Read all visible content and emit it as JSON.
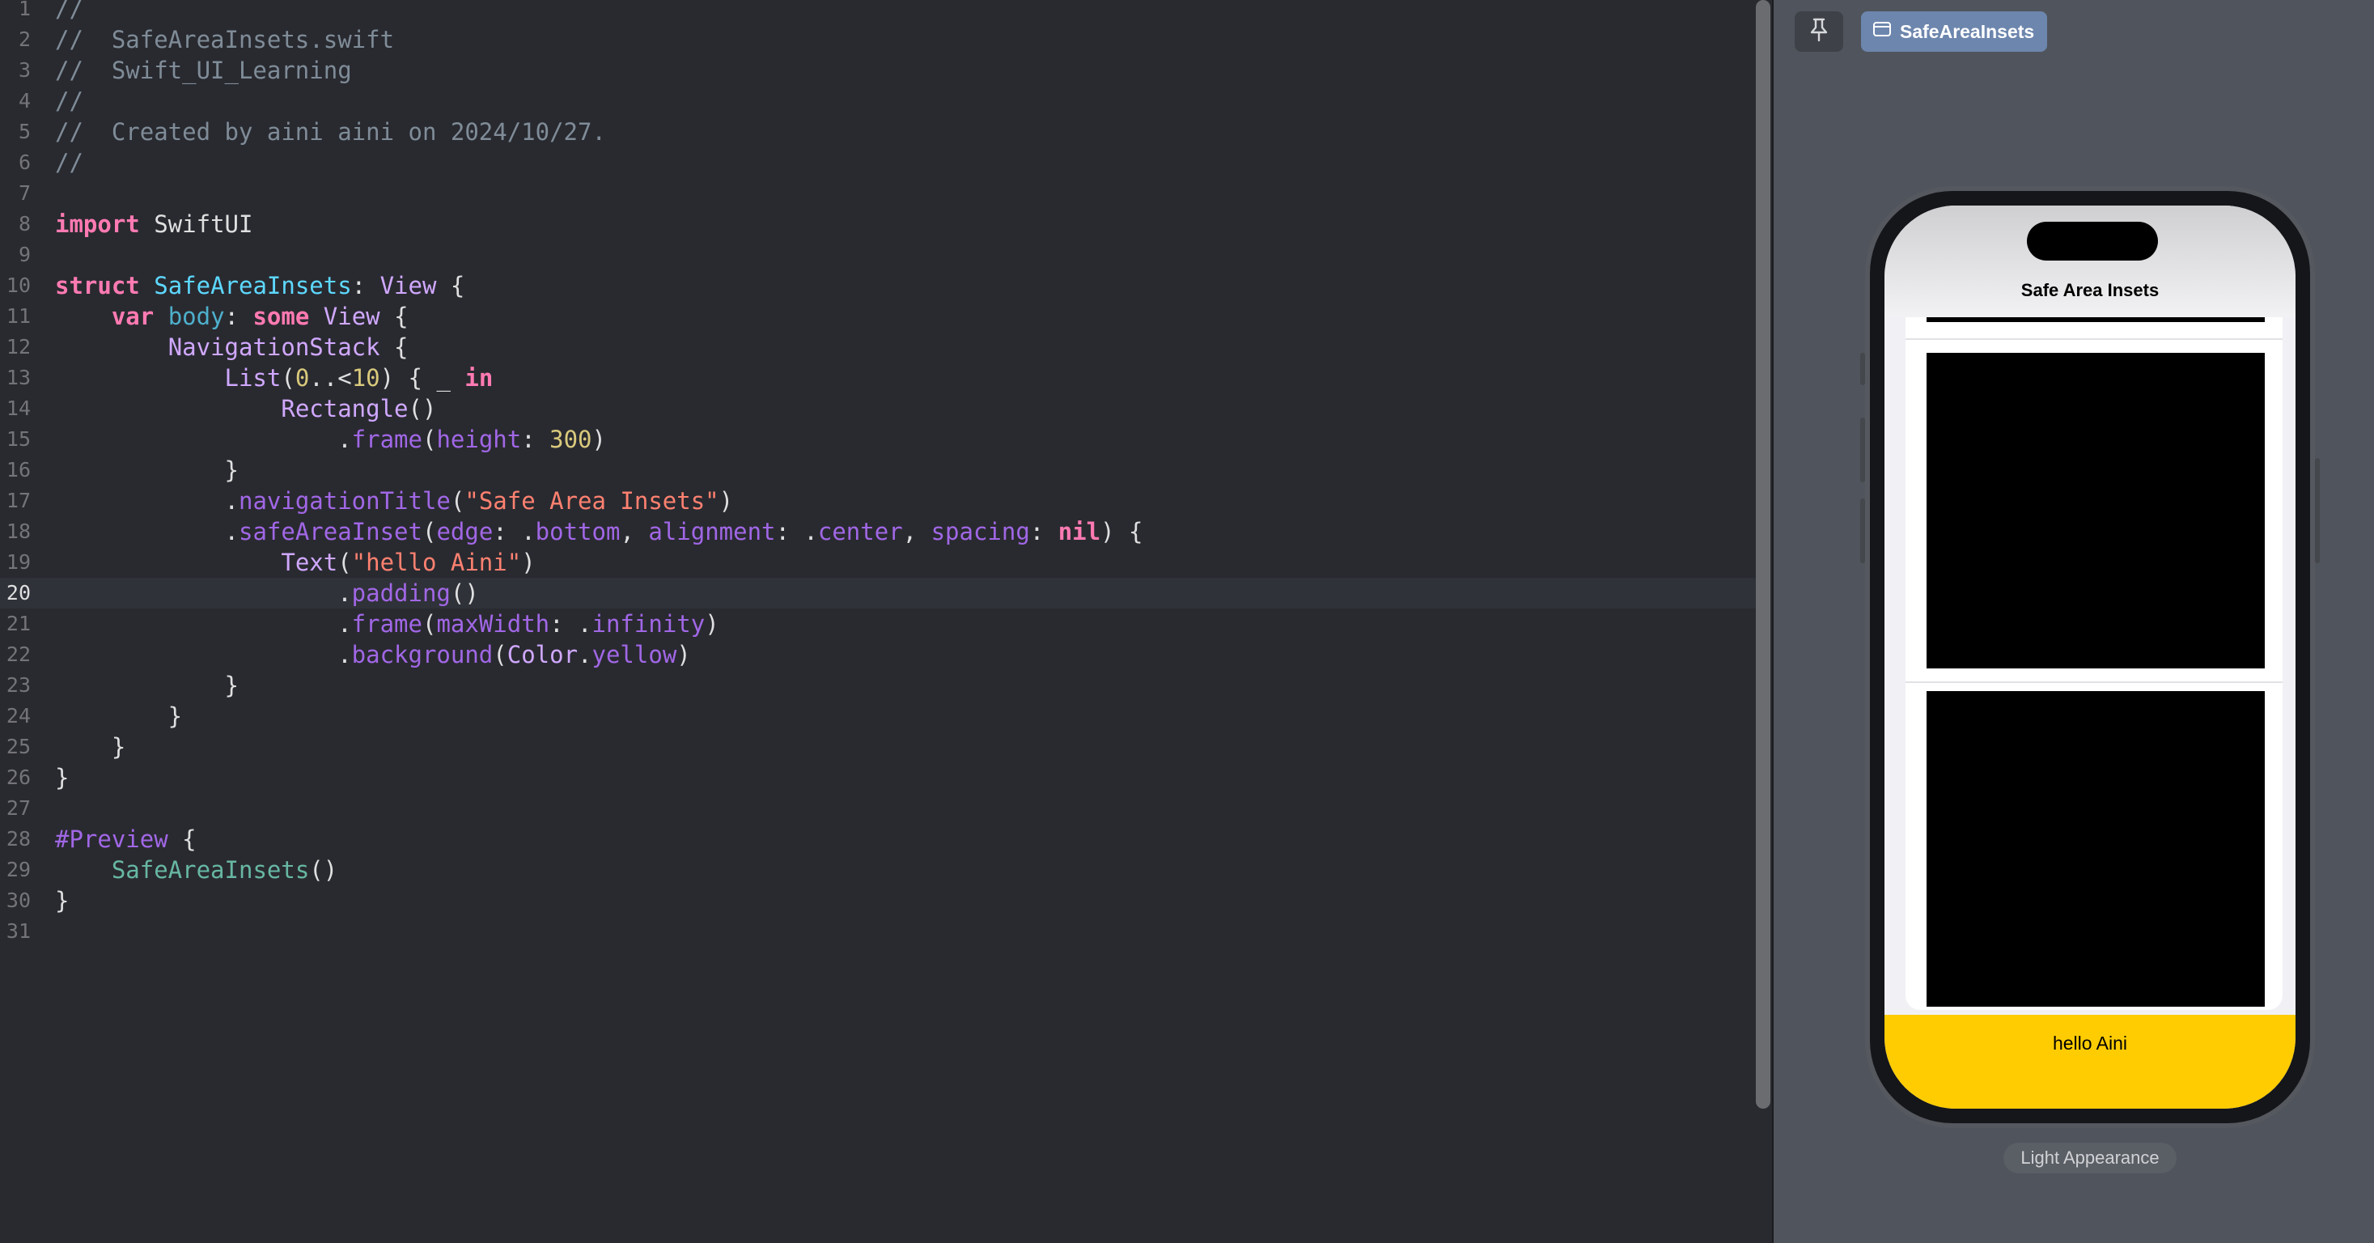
{
  "editor": {
    "current_line": 20,
    "lines": [
      {
        "n": "1",
        "tokens": [
          {
            "c": "com",
            "t": "//"
          }
        ]
      },
      {
        "n": "2",
        "tokens": [
          {
            "c": "com",
            "t": "//  SafeAreaInsets.swift"
          }
        ]
      },
      {
        "n": "3",
        "tokens": [
          {
            "c": "com",
            "t": "//  Swift_UI_Learning"
          }
        ]
      },
      {
        "n": "4",
        "tokens": [
          {
            "c": "com",
            "t": "//"
          }
        ]
      },
      {
        "n": "5",
        "tokens": [
          {
            "c": "com",
            "t": "//  Created by aini aini on 2024/10/27."
          }
        ]
      },
      {
        "n": "6",
        "tokens": [
          {
            "c": "com",
            "t": "//"
          }
        ]
      },
      {
        "n": "7",
        "tokens": []
      },
      {
        "n": "8",
        "tokens": [
          {
            "c": "kw",
            "t": "import"
          },
          {
            "c": "pun",
            "t": " SwiftUI"
          }
        ]
      },
      {
        "n": "9",
        "tokens": []
      },
      {
        "n": "10",
        "tokens": [
          {
            "c": "kw",
            "t": "struct"
          },
          {
            "c": "pun",
            "t": " "
          },
          {
            "c": "tdef",
            "t": "SafeAreaInsets"
          },
          {
            "c": "pun",
            "t": ": "
          },
          {
            "c": "typ",
            "t": "View"
          },
          {
            "c": "pun",
            "t": " {"
          }
        ]
      },
      {
        "n": "11",
        "tokens": [
          {
            "c": "pun",
            "t": "    "
          },
          {
            "c": "kw",
            "t": "var"
          },
          {
            "c": "pun",
            "t": " "
          },
          {
            "c": "func",
            "t": "body"
          },
          {
            "c": "pun",
            "t": ": "
          },
          {
            "c": "kw",
            "t": "some"
          },
          {
            "c": "pun",
            "t": " "
          },
          {
            "c": "typ",
            "t": "View"
          },
          {
            "c": "pun",
            "t": " {"
          }
        ]
      },
      {
        "n": "12",
        "tokens": [
          {
            "c": "pun",
            "t": "        "
          },
          {
            "c": "typ",
            "t": "NavigationStack"
          },
          {
            "c": "pun",
            "t": " {"
          }
        ]
      },
      {
        "n": "13",
        "tokens": [
          {
            "c": "pun",
            "t": "            "
          },
          {
            "c": "typ",
            "t": "List"
          },
          {
            "c": "pun",
            "t": "("
          },
          {
            "c": "num",
            "t": "0"
          },
          {
            "c": "pun",
            "t": "..<"
          },
          {
            "c": "num",
            "t": "10"
          },
          {
            "c": "pun",
            "t": ") { _ "
          },
          {
            "c": "kw",
            "t": "in"
          }
        ]
      },
      {
        "n": "14",
        "tokens": [
          {
            "c": "pun",
            "t": "                "
          },
          {
            "c": "typ",
            "t": "Rectangle"
          },
          {
            "c": "pun",
            "t": "()"
          }
        ]
      },
      {
        "n": "15",
        "tokens": [
          {
            "c": "pun",
            "t": "                    ."
          },
          {
            "c": "proj",
            "t": "frame"
          },
          {
            "c": "pun",
            "t": "("
          },
          {
            "c": "proj",
            "t": "height"
          },
          {
            "c": "pun",
            "t": ": "
          },
          {
            "c": "num",
            "t": "300"
          },
          {
            "c": "pun",
            "t": ")"
          }
        ]
      },
      {
        "n": "16",
        "tokens": [
          {
            "c": "pun",
            "t": "            }"
          }
        ]
      },
      {
        "n": "17",
        "tokens": [
          {
            "c": "pun",
            "t": "            ."
          },
          {
            "c": "proj",
            "t": "navigationTitle"
          },
          {
            "c": "pun",
            "t": "("
          },
          {
            "c": "str",
            "t": "\"Safe Area Insets\""
          },
          {
            "c": "pun",
            "t": ")"
          }
        ]
      },
      {
        "n": "18",
        "tokens": [
          {
            "c": "pun",
            "t": "            ."
          },
          {
            "c": "proj",
            "t": "safeAreaInset"
          },
          {
            "c": "pun",
            "t": "("
          },
          {
            "c": "proj",
            "t": "edge"
          },
          {
            "c": "pun",
            "t": ": ."
          },
          {
            "c": "proj",
            "t": "bottom"
          },
          {
            "c": "pun",
            "t": ", "
          },
          {
            "c": "proj",
            "t": "alignment"
          },
          {
            "c": "pun",
            "t": ": ."
          },
          {
            "c": "proj",
            "t": "center"
          },
          {
            "c": "pun",
            "t": ", "
          },
          {
            "c": "proj",
            "t": "spacing"
          },
          {
            "c": "pun",
            "t": ": "
          },
          {
            "c": "kw",
            "t": "nil"
          },
          {
            "c": "pun",
            "t": ") {"
          }
        ]
      },
      {
        "n": "19",
        "tokens": [
          {
            "c": "pun",
            "t": "                "
          },
          {
            "c": "typ",
            "t": "Text"
          },
          {
            "c": "pun",
            "t": "("
          },
          {
            "c": "str",
            "t": "\"hello Aini\""
          },
          {
            "c": "pun",
            "t": ")"
          }
        ]
      },
      {
        "n": "20",
        "tokens": [
          {
            "c": "pun",
            "t": "                    ."
          },
          {
            "c": "proj",
            "t": "padding"
          },
          {
            "c": "pun",
            "t": "()"
          }
        ]
      },
      {
        "n": "21",
        "tokens": [
          {
            "c": "pun",
            "t": "                    ."
          },
          {
            "c": "proj",
            "t": "frame"
          },
          {
            "c": "pun",
            "t": "("
          },
          {
            "c": "proj",
            "t": "maxWidth"
          },
          {
            "c": "pun",
            "t": ": ."
          },
          {
            "c": "proj",
            "t": "infinity"
          },
          {
            "c": "pun",
            "t": ")"
          }
        ]
      },
      {
        "n": "22",
        "tokens": [
          {
            "c": "pun",
            "t": "                    ."
          },
          {
            "c": "proj",
            "t": "background"
          },
          {
            "c": "pun",
            "t": "("
          },
          {
            "c": "typ",
            "t": "Color"
          },
          {
            "c": "pun",
            "t": "."
          },
          {
            "c": "proj",
            "t": "yellow"
          },
          {
            "c": "pun",
            "t": ")"
          }
        ]
      },
      {
        "n": "23",
        "tokens": [
          {
            "c": "pun",
            "t": "            }"
          }
        ]
      },
      {
        "n": "24",
        "tokens": [
          {
            "c": "pun",
            "t": "        }"
          }
        ]
      },
      {
        "n": "25",
        "tokens": [
          {
            "c": "pun",
            "t": "    }"
          }
        ]
      },
      {
        "n": "26",
        "tokens": [
          {
            "c": "pun",
            "t": "}"
          }
        ]
      },
      {
        "n": "27",
        "tokens": []
      },
      {
        "n": "28",
        "tokens": [
          {
            "c": "proj",
            "t": "#Preview"
          },
          {
            "c": "pun",
            "t": " {"
          }
        ]
      },
      {
        "n": "29",
        "tokens": [
          {
            "c": "pun",
            "t": "    "
          },
          {
            "c": "proj-name",
            "t": "SafeAreaInsets"
          },
          {
            "c": "pun",
            "t": "()"
          }
        ]
      },
      {
        "n": "30",
        "tokens": [
          {
            "c": "pun",
            "t": "}"
          }
        ]
      },
      {
        "n": "31",
        "tokens": []
      }
    ]
  },
  "preview": {
    "pin_icon": "pin-icon",
    "tab_icon": "window-icon",
    "tab_label": "SafeAreaInsets",
    "nav_title": "Safe Area Insets",
    "inset_text": "hello Aini",
    "appearance_label": "Light Appearance"
  },
  "colors": {
    "editor_bg": "#292a30",
    "canvas_bg": "#50545c",
    "tab_accent": "#6d86ad",
    "inset_yellow": "#ffcc02"
  }
}
